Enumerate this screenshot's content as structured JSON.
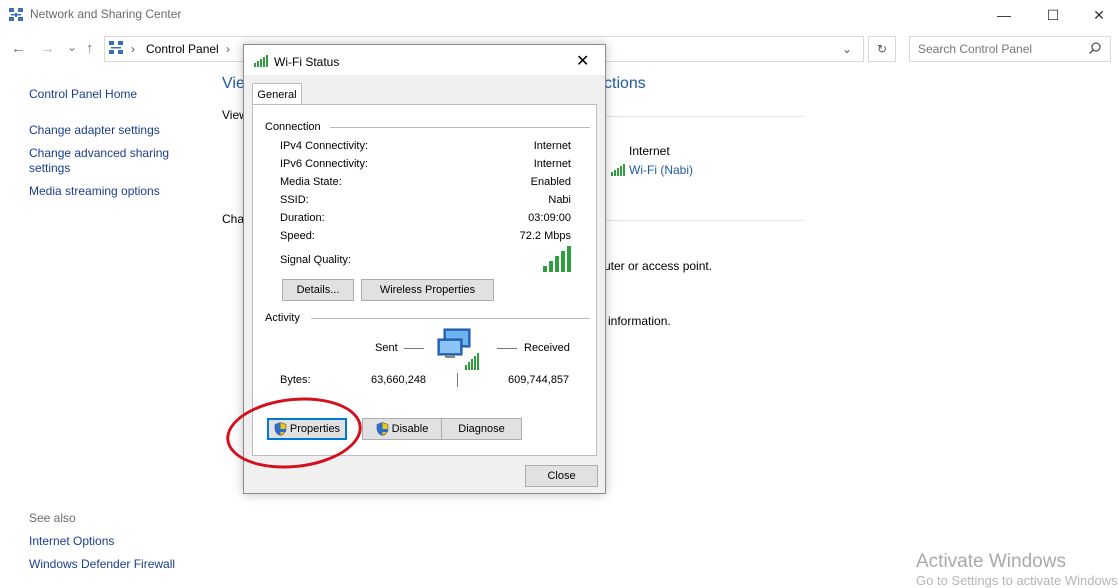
{
  "window": {
    "title": "Network and Sharing Center",
    "controls": {
      "minimize": "—",
      "maximize": "☐",
      "close": "✕"
    }
  },
  "address": {
    "back": "←",
    "forward": "→",
    "history": "⌄",
    "up": "↑",
    "separator": "›",
    "path": "Control Panel",
    "dropdown": "⌄",
    "refresh": "↻",
    "search_placeholder": "Search Control Panel"
  },
  "sidebar": {
    "home": "Control Panel Home",
    "links": [
      "Change adapter settings",
      "Change advanced sharing",
      "settings",
      "Media streaming options"
    ],
    "see_also": "See also",
    "see_also_links": [
      "Internet Options",
      "Windows Defender Firewall"
    ]
  },
  "main_fragments": {
    "heading_start": "Vie",
    "heading_end": "ctions",
    "view_start": "View",
    "change_start": "Cha",
    "internet": "Internet",
    "wifi_link": "Wi-Fi (Nabi)",
    "router_text": "uter or access point.",
    "info_text": "information."
  },
  "dialog": {
    "title": "Wi-Fi Status",
    "close": "✕",
    "tab": "General",
    "connection": {
      "label": "Connection",
      "rows": [
        {
          "label": "IPv4 Connectivity:",
          "value": "Internet"
        },
        {
          "label": "IPv6 Connectivity:",
          "value": "Internet"
        },
        {
          "label": "Media State:",
          "value": "Enabled"
        },
        {
          "label": "SSID:",
          "value": "Nabi"
        },
        {
          "label": "Duration:",
          "value": "03:09:00"
        },
        {
          "label": "Speed:",
          "value": "72.2 Mbps"
        }
      ],
      "signal_label": "Signal Quality:",
      "signal_bars": 5
    },
    "buttons_top": {
      "details": "Details...",
      "wireless": "Wireless Properties"
    },
    "activity": {
      "label": "Activity",
      "sent": "Sent",
      "received": "Received",
      "bytes_label": "Bytes:",
      "bytes_sent": "63,660,248",
      "bytes_received": "609,744,857"
    },
    "buttons_bottom": {
      "properties": "Properties",
      "disable": "Disable",
      "diagnose": "Diagnose"
    },
    "close_button": "Close"
  },
  "watermark": {
    "line1": "Activate Windows",
    "line2": "Go to Settings to activate Windows."
  },
  "colors": {
    "link": "#1a3e8c",
    "annotation": "#d4101d",
    "signal": "#2e9e3e"
  }
}
